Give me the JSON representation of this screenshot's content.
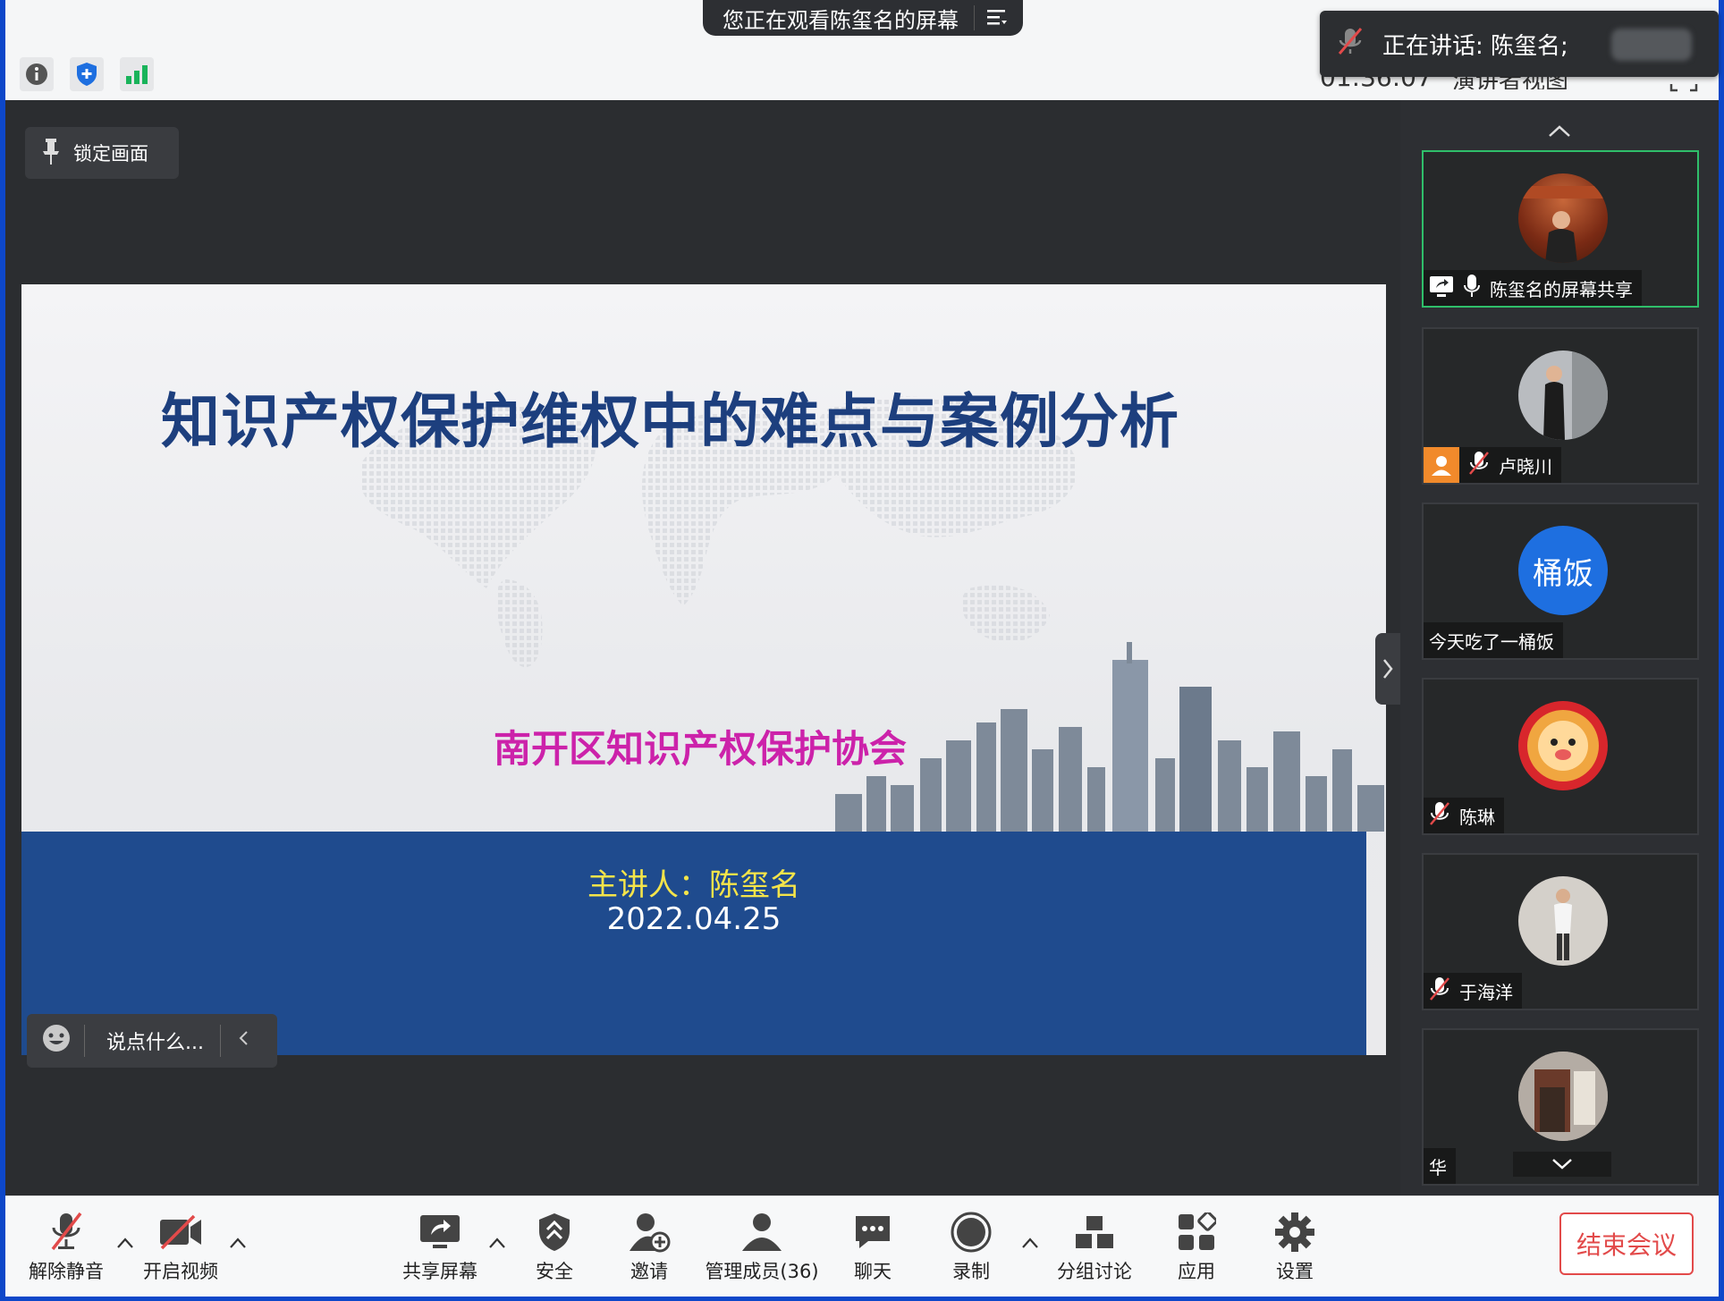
{
  "header": {
    "viewing_text": "您正在观看陈玺名的屏幕",
    "speaking_text": "正在讲话: 陈玺名;",
    "clock_text": "01:36:07",
    "layout_text": "演讲者视图"
  },
  "stage": {
    "lock_label": "锁定画面",
    "chat_placeholder": "说点什么..."
  },
  "slide": {
    "title": "知识产权保护维权中的难点与案例分析",
    "subtitle": "南开区知识产权保护协会",
    "presenter": "主讲人：陈玺名",
    "date": "2022.04.25"
  },
  "participants": [
    {
      "name": "陈玺名的屏幕共享",
      "muted": false,
      "sharing": true,
      "active": true
    },
    {
      "name": "卢晓川",
      "muted": true
    },
    {
      "name": "今天吃了一桶饭",
      "avatar_text": "桶饭",
      "muted": false
    },
    {
      "name": "陈琳",
      "muted": true
    },
    {
      "name": "于海洋",
      "muted": true
    },
    {
      "name": "华",
      "muted": false
    }
  ],
  "toolbar": {
    "unmute": "解除静音",
    "start_video": "开启视频",
    "share_screen": "共享屏幕",
    "security": "安全",
    "invite": "邀请",
    "manage_members": "管理成员(36)",
    "chat": "聊天",
    "record": "录制",
    "breakout": "分组讨论",
    "apps": "应用",
    "settings": "设置",
    "end_meeting": "结束会议"
  },
  "colors": {
    "accent_green": "#2fbf6a",
    "end_red": "#e24a4a",
    "slide_title": "#1d3f7e",
    "slide_subtitle": "#cc22aa",
    "slide_band": "#1f4b8e"
  }
}
